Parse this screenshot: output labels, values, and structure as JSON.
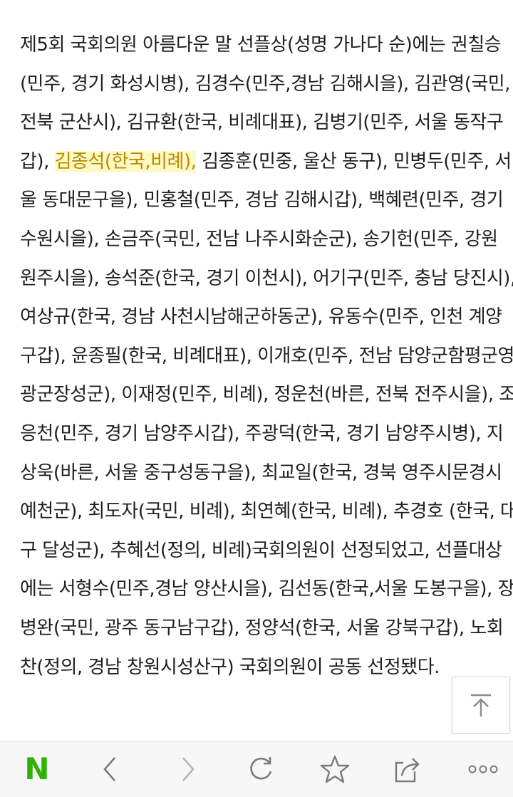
{
  "article": {
    "lines": [
      {
        "text": "제5회 국회의원 아름다운 말 선플상(성명 가나다 순)에는 권칠승"
      },
      {
        "text": "(민주, 경기 화성시병), 김경수(민주,경남 김해시을), 김관영(국민,"
      },
      {
        "text": "전북 군산시), 김규환(한국, 비례대표), 김병기(민주, 서울 동작구"
      },
      {
        "before": "갑), ",
        "highlight": "김종석(한국,비례),",
        "after": " 김종훈(민중, 울산 동구), 민병두(민주, 서"
      },
      {
        "text": "울 동대문구을), 민홍철(민주, 경남 김해시갑), 백혜련(민주, 경기"
      },
      {
        "text": "수원시을), 손금주(국민, 전남 나주시화순군), 송기헌(민주, 강원"
      },
      {
        "text": "원주시을), 송석준(한국, 경기 이천시), 어기구(민주, 충남 당진시),"
      },
      {
        "text": "여상규(한국, 경남 사천시남해군하동군), 유동수(민주, 인천 계양"
      },
      {
        "text": "구갑), 윤종필(한국, 비례대표), 이개호(민주, 전남 담양군함평군영"
      },
      {
        "text": "광군장성군), 이재정(민주, 비례), 정운천(바른, 전북 전주시을), 조"
      },
      {
        "text": "응천(민주, 경기 남양주시갑), 주광덕(한국, 경기 남양주시병), 지"
      },
      {
        "text": "상욱(바른, 서울 중구성동구을), 최교일(한국, 경북 영주시문경시"
      },
      {
        "text": "예천군), 최도자(국민, 비례), 최연혜(한국, 비례), 추경호 (한국, 대"
      },
      {
        "text": "구 달성군), 추혜선(정의, 비례)국회의원이 선정되었고, 선플대상"
      },
      {
        "text": "에는 서형수(민주,경남 양산시을), 김선동(한국,서울 도봉구을), 장"
      },
      {
        "text": "병완(국민, 광주 동구남구갑), 정양석(한국, 서울 강북구갑), 노회"
      },
      {
        "text": "찬(정의, 경남 창원시성산구) 국회의원이 공동 선정됐다."
      }
    ]
  },
  "colors": {
    "text": "#1f1f1f",
    "highlight_text": "#b88a00",
    "naver_green": "#2db400",
    "icon_gray": "#7a7a7a"
  },
  "scroll_top": {
    "icon": "arrow-up-to-top-icon"
  },
  "bottom_bar": {
    "logo_text": "N",
    "buttons": [
      {
        "name": "naver-home-button",
        "icon": "naver-logo"
      },
      {
        "name": "back-button",
        "icon": "chevron-left-icon"
      },
      {
        "name": "forward-button",
        "icon": "chevron-right-icon"
      },
      {
        "name": "reload-button",
        "icon": "reload-icon"
      },
      {
        "name": "bookmark-button",
        "icon": "star-icon"
      },
      {
        "name": "share-button",
        "icon": "share-icon"
      },
      {
        "name": "more-button",
        "icon": "more-dots-icon"
      }
    ]
  }
}
